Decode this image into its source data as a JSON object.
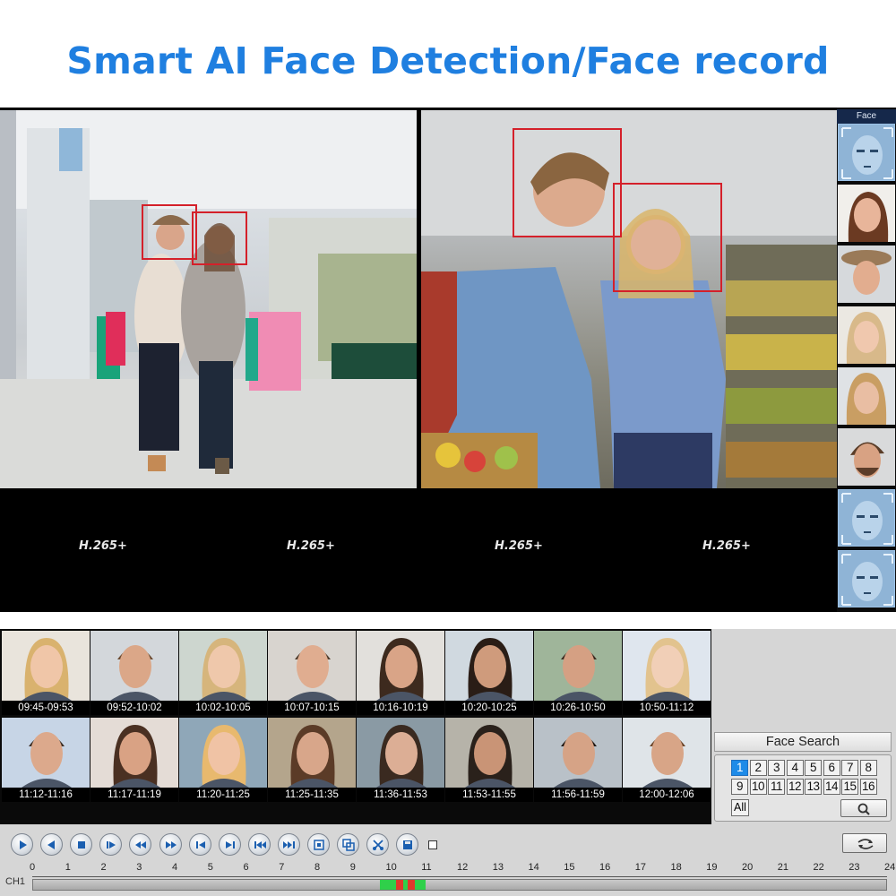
{
  "title": "Smart AI Face Detection/Face record",
  "live": {
    "codecs": [
      "H.265+",
      "H.265+",
      "H.265+",
      "H.265+"
    ],
    "face_panel": {
      "title": "Face",
      "thumbs": [
        "face-scan-icon",
        "woman-smiling",
        "woman-hat",
        "woman-blonde",
        "woman-blonde-2",
        "man-beard",
        "face-scan-icon",
        "face-scan-icon"
      ]
    }
  },
  "playback": {
    "results_row1": [
      "09:45-09:53",
      "09:52-10:02",
      "10:02-10:05",
      "10:07-10:15",
      "10:16-10:19",
      "10:20-10:25",
      "10:26-10:50",
      "10:50-11:12"
    ],
    "results_row2": [
      "11:12-11:16",
      "11:17-11:19",
      "11:20-11:25",
      "11:25-11:35",
      "11:36-11:53",
      "11:53-11:55",
      "11:56-11:59",
      "12:00-12:06"
    ],
    "face_search": {
      "title": "Face Search",
      "channels": [
        "1",
        "2",
        "3",
        "4",
        "5",
        "6",
        "7",
        "8",
        "9",
        "10",
        "11",
        "12",
        "13",
        "14",
        "15",
        "16"
      ],
      "active_channel": "1",
      "all_label": "All"
    },
    "controls": [
      "play-icon",
      "reverse-icon",
      "stop-icon",
      "step-forward-icon",
      "rewind-icon",
      "fast-forward-icon",
      "previous-icon",
      "next-icon",
      "slow-icon",
      "speed-icon",
      "zoom-in-icon",
      "zoom-out-icon",
      "clip-icon",
      "save-icon"
    ],
    "timeline": {
      "channel_label": "CH1",
      "hours": [
        "0",
        "1",
        "2",
        "3",
        "4",
        "5",
        "6",
        "7",
        "8",
        "9",
        "10",
        "11",
        "12",
        "13",
        "14",
        "15",
        "16",
        "17",
        "18",
        "19",
        "20",
        "21",
        "22",
        "23",
        "24"
      ],
      "recorded": [
        {
          "from": 9.75,
          "to": 10.2,
          "color": "#2fd04a"
        },
        {
          "from": 10.2,
          "to": 10.4,
          "color": "#e03a2c"
        },
        {
          "from": 10.4,
          "to": 10.55,
          "color": "#2fd04a"
        },
        {
          "from": 10.55,
          "to": 10.75,
          "color": "#e03a2c"
        },
        {
          "from": 10.75,
          "to": 11.05,
          "color": "#2fd04a"
        }
      ]
    }
  },
  "colors": {
    "title": "#1f7fe0",
    "face_box": "#d4202a",
    "active_channel": "#1e8be8",
    "selected_result": "#d42020"
  }
}
